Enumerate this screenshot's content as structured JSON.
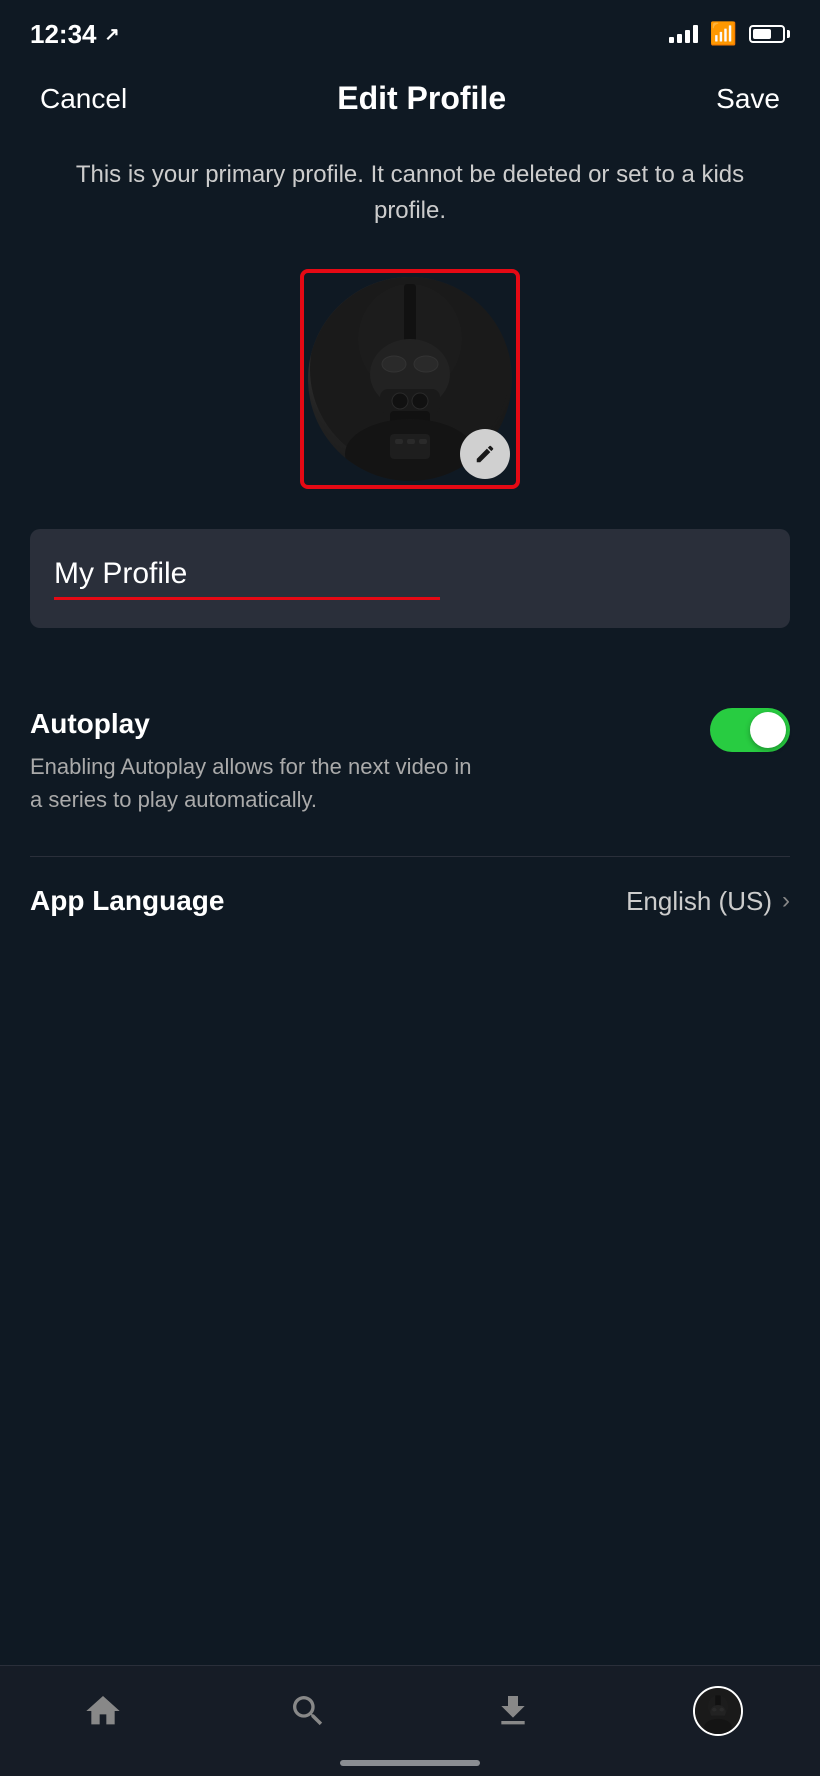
{
  "statusBar": {
    "time": "12:34",
    "locationArrow": "↗"
  },
  "navBar": {
    "cancelLabel": "Cancel",
    "titleLabel": "Edit Profile",
    "saveLabel": "Save"
  },
  "primaryNotice": "This is your primary profile. It cannot be deleted or set to a kids profile.",
  "profileName": {
    "value": "My Profile"
  },
  "autoplay": {
    "label": "Autoplay",
    "description": "Enabling Autoplay allows for the next video in a series to play automatically.",
    "enabled": true
  },
  "appLanguage": {
    "label": "App Language",
    "value": "English (US)"
  },
  "tabBar": {
    "items": [
      {
        "name": "Home",
        "icon": "home"
      },
      {
        "name": "Search",
        "icon": "search"
      },
      {
        "name": "Downloads",
        "icon": "download"
      },
      {
        "name": "Profile",
        "icon": "profile"
      }
    ]
  }
}
